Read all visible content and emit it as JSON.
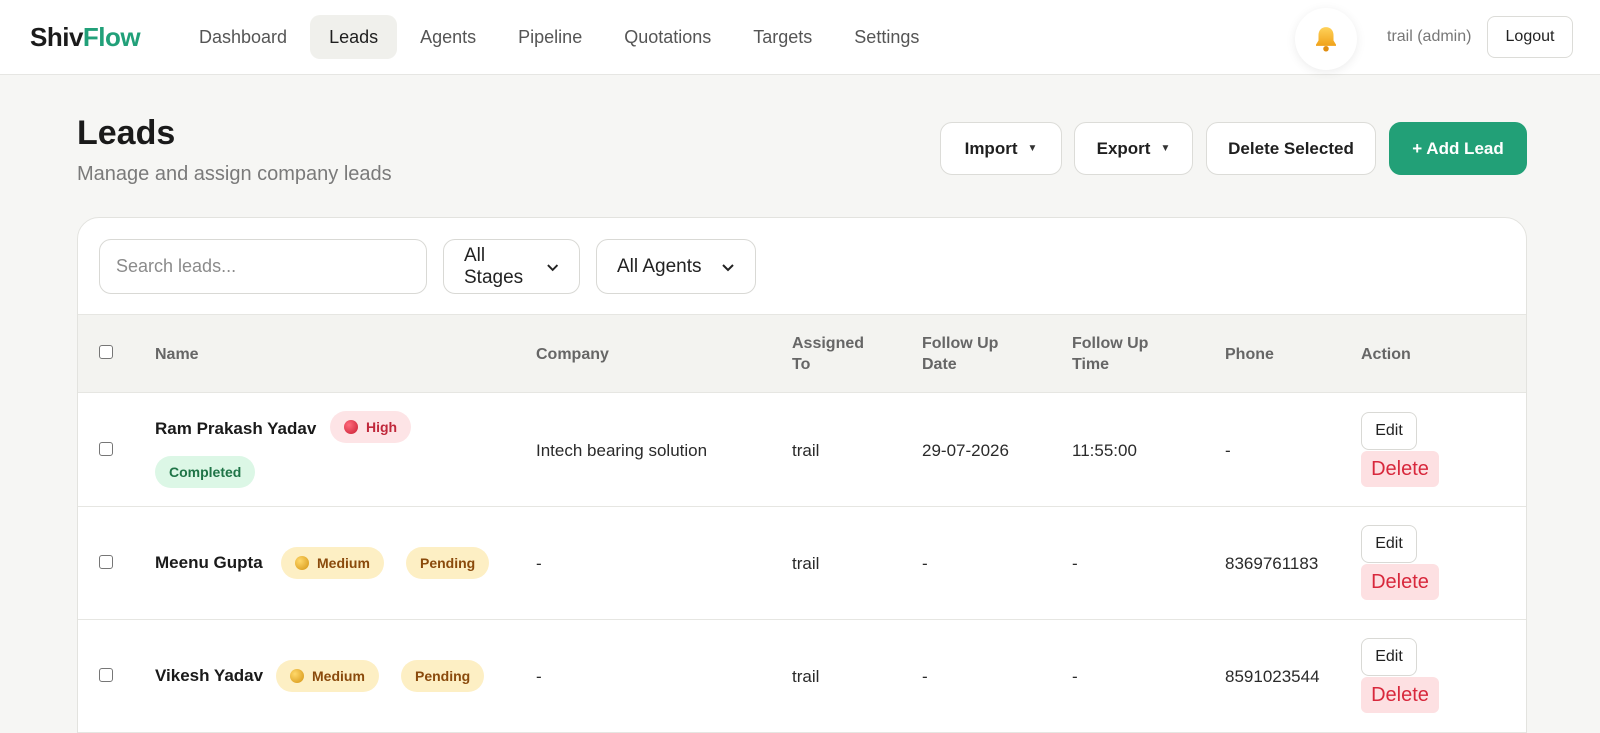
{
  "brand": {
    "part1": "Shiv",
    "part2": "Flow"
  },
  "nav": {
    "items": [
      {
        "label": "Dashboard"
      },
      {
        "label": "Leads",
        "active": true
      },
      {
        "label": "Agents"
      },
      {
        "label": "Pipeline"
      },
      {
        "label": "Quotations"
      },
      {
        "label": "Targets"
      },
      {
        "label": "Settings"
      }
    ]
  },
  "user": {
    "label": "trail (admin)",
    "logout_label": "Logout",
    "bell_icon": "bell-icon"
  },
  "page": {
    "title": "Leads",
    "subtitle": "Manage and assign company leads"
  },
  "actions": {
    "import_label": "Import",
    "export_label": "Export",
    "delete_selected_label": "Delete Selected",
    "add_lead_label": "+ Add Lead"
  },
  "filters": {
    "search_placeholder": "Search leads...",
    "stage_selected": "All Stages",
    "agent_selected": "All Agents"
  },
  "table": {
    "headers": {
      "name": "Name",
      "company": "Company",
      "assigned_line1": "Assigned",
      "assigned_line2": "To",
      "followdate_line1": "Follow Up",
      "followdate_line2": "Date",
      "followtime_line1": "Follow Up",
      "followtime_line2": "Time",
      "phone": "Phone",
      "action": "Action"
    },
    "edit_label": "Edit",
    "delete_label": "Delete",
    "rows": [
      {
        "name": "Ram Prakash Yadav",
        "priority": "High",
        "status": "Completed",
        "company": "Intech bearing solution",
        "assigned_to": "trail",
        "follow_date": "29-07-2026",
        "follow_time": "11:55:00",
        "phone": "-"
      },
      {
        "name": "Meenu Gupta",
        "priority": "Medium",
        "status": "Pending",
        "company": "-",
        "assigned_to": "trail",
        "follow_date": "-",
        "follow_time": "-",
        "phone": "8369761183"
      },
      {
        "name": "Vikesh Yadav",
        "priority": "Medium",
        "status": "Pending",
        "company": "-",
        "assigned_to": "trail",
        "follow_date": "-",
        "follow_time": "-",
        "phone": "8591023544"
      }
    ]
  },
  "colors": {
    "accent": "#22a077",
    "danger": "#d8283c",
    "high_bg": "#fde4e6",
    "medium_bg": "#fdefc4",
    "completed_bg": "#dcf7e6"
  }
}
